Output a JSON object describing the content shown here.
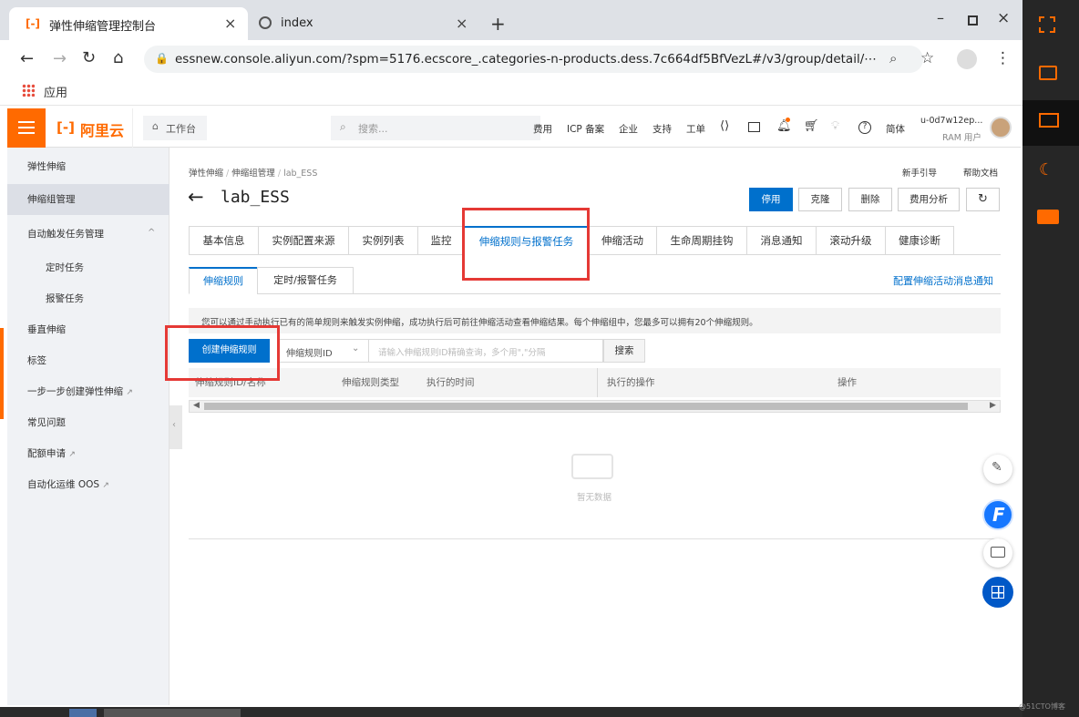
{
  "browser": {
    "tab_title": "弹性伸缩管理控制台",
    "tab2_title": "index",
    "url": "essnew.console.aliyun.com/?spm=5176.ecscore_.categories-n-products.dess.7c664df5BfVezL#/v3/group/detail/⋯",
    "bookmarks_label": "应用"
  },
  "header": {
    "logo_text": "阿里云",
    "workbench": "工作台",
    "search_placeholder": "搜索...",
    "nav": [
      "费用",
      "ICP 备案",
      "企业",
      "支持",
      "工单"
    ],
    "lang": "简体",
    "user_name": "u-0d7w12ep...",
    "user_role": "RAM 用户"
  },
  "leftnav": {
    "items": [
      {
        "label": "弹性伸缩"
      },
      {
        "label": "伸缩组管理"
      },
      {
        "label": "自动触发任务管理"
      },
      {
        "label": "定时任务"
      },
      {
        "label": "报警任务"
      },
      {
        "label": "垂直伸缩"
      },
      {
        "label": "标签"
      },
      {
        "label": "一步一步创建弹性伸缩"
      },
      {
        "label": "常见问题"
      },
      {
        "label": "配额申请"
      },
      {
        "label": "自动化运维 OOS"
      }
    ]
  },
  "page": {
    "breadcrumb": [
      "弹性伸缩",
      "伸缩组管理",
      "lab_ESS"
    ],
    "guide_link": "新手引导",
    "docs_link": "帮助文档",
    "title": "lab_ESS",
    "actions": {
      "disable": "停用",
      "clone": "克隆",
      "delete": "删除",
      "cost": "费用分析"
    },
    "tabs": [
      "基本信息",
      "实例配置来源",
      "实例列表",
      "监控",
      "伸缩规则与报警任务",
      "伸缩活动",
      "生命周期挂钩",
      "消息通知",
      "滚动升级",
      "健康诊断"
    ],
    "subtabs": [
      "伸缩规则",
      "定时/报警任务"
    ],
    "config_link": "配置伸缩活动消息通知",
    "info_text": "您可以通过手动执行已有的简单规则来触发实例伸缩，成功执行后可前往伸缩活动查看伸缩结果。每个伸缩组中，您最多可以拥有20个伸缩规则。",
    "create_button": "创建伸缩规则",
    "filter_select": "伸缩规则ID",
    "filter_placeholder": "请输入伸缩规则ID精确查询，多个用\",\"分隔",
    "search_button": "搜索",
    "columns": [
      "伸缩规则ID/名称",
      "伸缩规则类型",
      "执行的时间",
      "执行的操作",
      "操作"
    ],
    "empty_text": "暂无数据"
  },
  "colors": {
    "brand": "#ff6a00",
    "primary": "#0070cc",
    "highlight": "#e53935"
  },
  "watermark": "@51CTO博客"
}
